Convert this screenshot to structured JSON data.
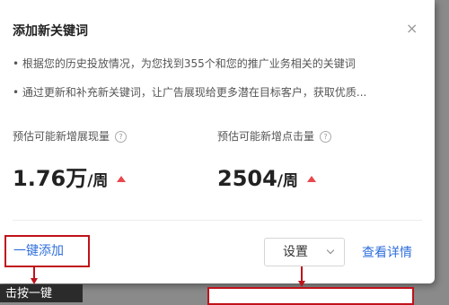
{
  "dialog": {
    "title": "添加新关键词",
    "close_symbol": "×",
    "tips": [
      "• 根据您的历史投放情况，为您找到355个和您的推广业务相关的关键词",
      "• 通过更新和补充新关键词，让广告展现给更多潜在目标客户，获取优质..."
    ]
  },
  "metrics": [
    {
      "label": "预估可能新增展现量",
      "value": "1.76万",
      "unit": "/周"
    },
    {
      "label": "预估可能新增点击量",
      "value": "2504",
      "unit": "/周"
    }
  ],
  "help_glyph": "?",
  "footer": {
    "one_click_add": "一键添加",
    "settings": "设置",
    "view_details": "查看详情"
  },
  "callout": {
    "label": "击按一键"
  },
  "colors": {
    "link": "#2f6fdb",
    "highlight_border": "#c0121a",
    "trend_up": "#e8474c"
  }
}
